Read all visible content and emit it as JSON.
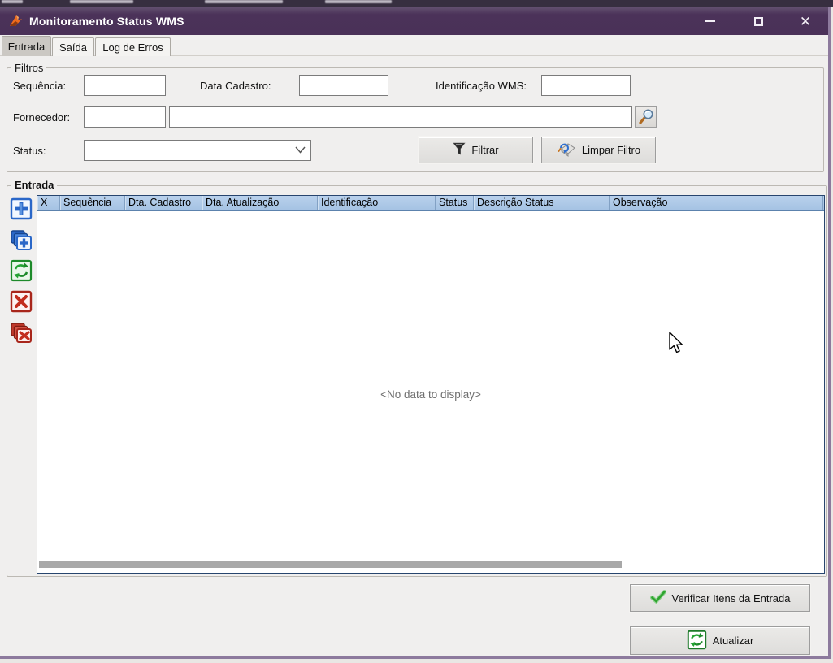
{
  "window": {
    "title": "Monitoramento Status WMS",
    "controls": {
      "minimize_glyph": "",
      "close_glyph": "✕"
    }
  },
  "tabs": {
    "items": [
      {
        "label": "Entrada",
        "active": true
      },
      {
        "label": "Saída",
        "active": false
      },
      {
        "label": "Log de Erros",
        "active": false
      }
    ]
  },
  "filters": {
    "group_label": "Filtros",
    "sequencia_label": "Sequência:",
    "data_cadastro_label": "Data Cadastro:",
    "identificacao_label": "Identificação WMS:",
    "fornecedor_label": "Fornecedor:",
    "status_label": "Status:",
    "sequencia_value": "",
    "data_cadastro_value": "",
    "identificacao_value": "",
    "fornecedor_codigo_value": "",
    "fornecedor_nome_value": "",
    "status_value": "",
    "filtrar_button": "Filtrar",
    "limpar_button": "Limpar Filtro",
    "icons": [
      "funnel-icon",
      "eraser-icon",
      "magnifier-icon"
    ]
  },
  "entrada": {
    "group_label": "Entrada",
    "columns": [
      "X",
      "Sequência",
      "Dta. Cadastro",
      "Dta. Atualização",
      "Identificação",
      "Status",
      "Descrição Status",
      "Observação"
    ],
    "empty_message": "<No data to display>",
    "toolbar_icons": [
      "add-icon",
      "add-multiple-icon",
      "refresh-icon",
      "delete-icon",
      "delete-multiple-icon"
    ]
  },
  "footer": {
    "verificar_button": "Verificar Itens da Entrada",
    "atualizar_button": "Atualizar",
    "icons": [
      "green-check-icon",
      "recycle-icon"
    ]
  },
  "colors": {
    "titlebar": "#4a3158",
    "window_border": "#8d7a9d",
    "grid_header": "#aac6e4",
    "grid_border": "#27456e",
    "client_bg": "#f0efee"
  }
}
